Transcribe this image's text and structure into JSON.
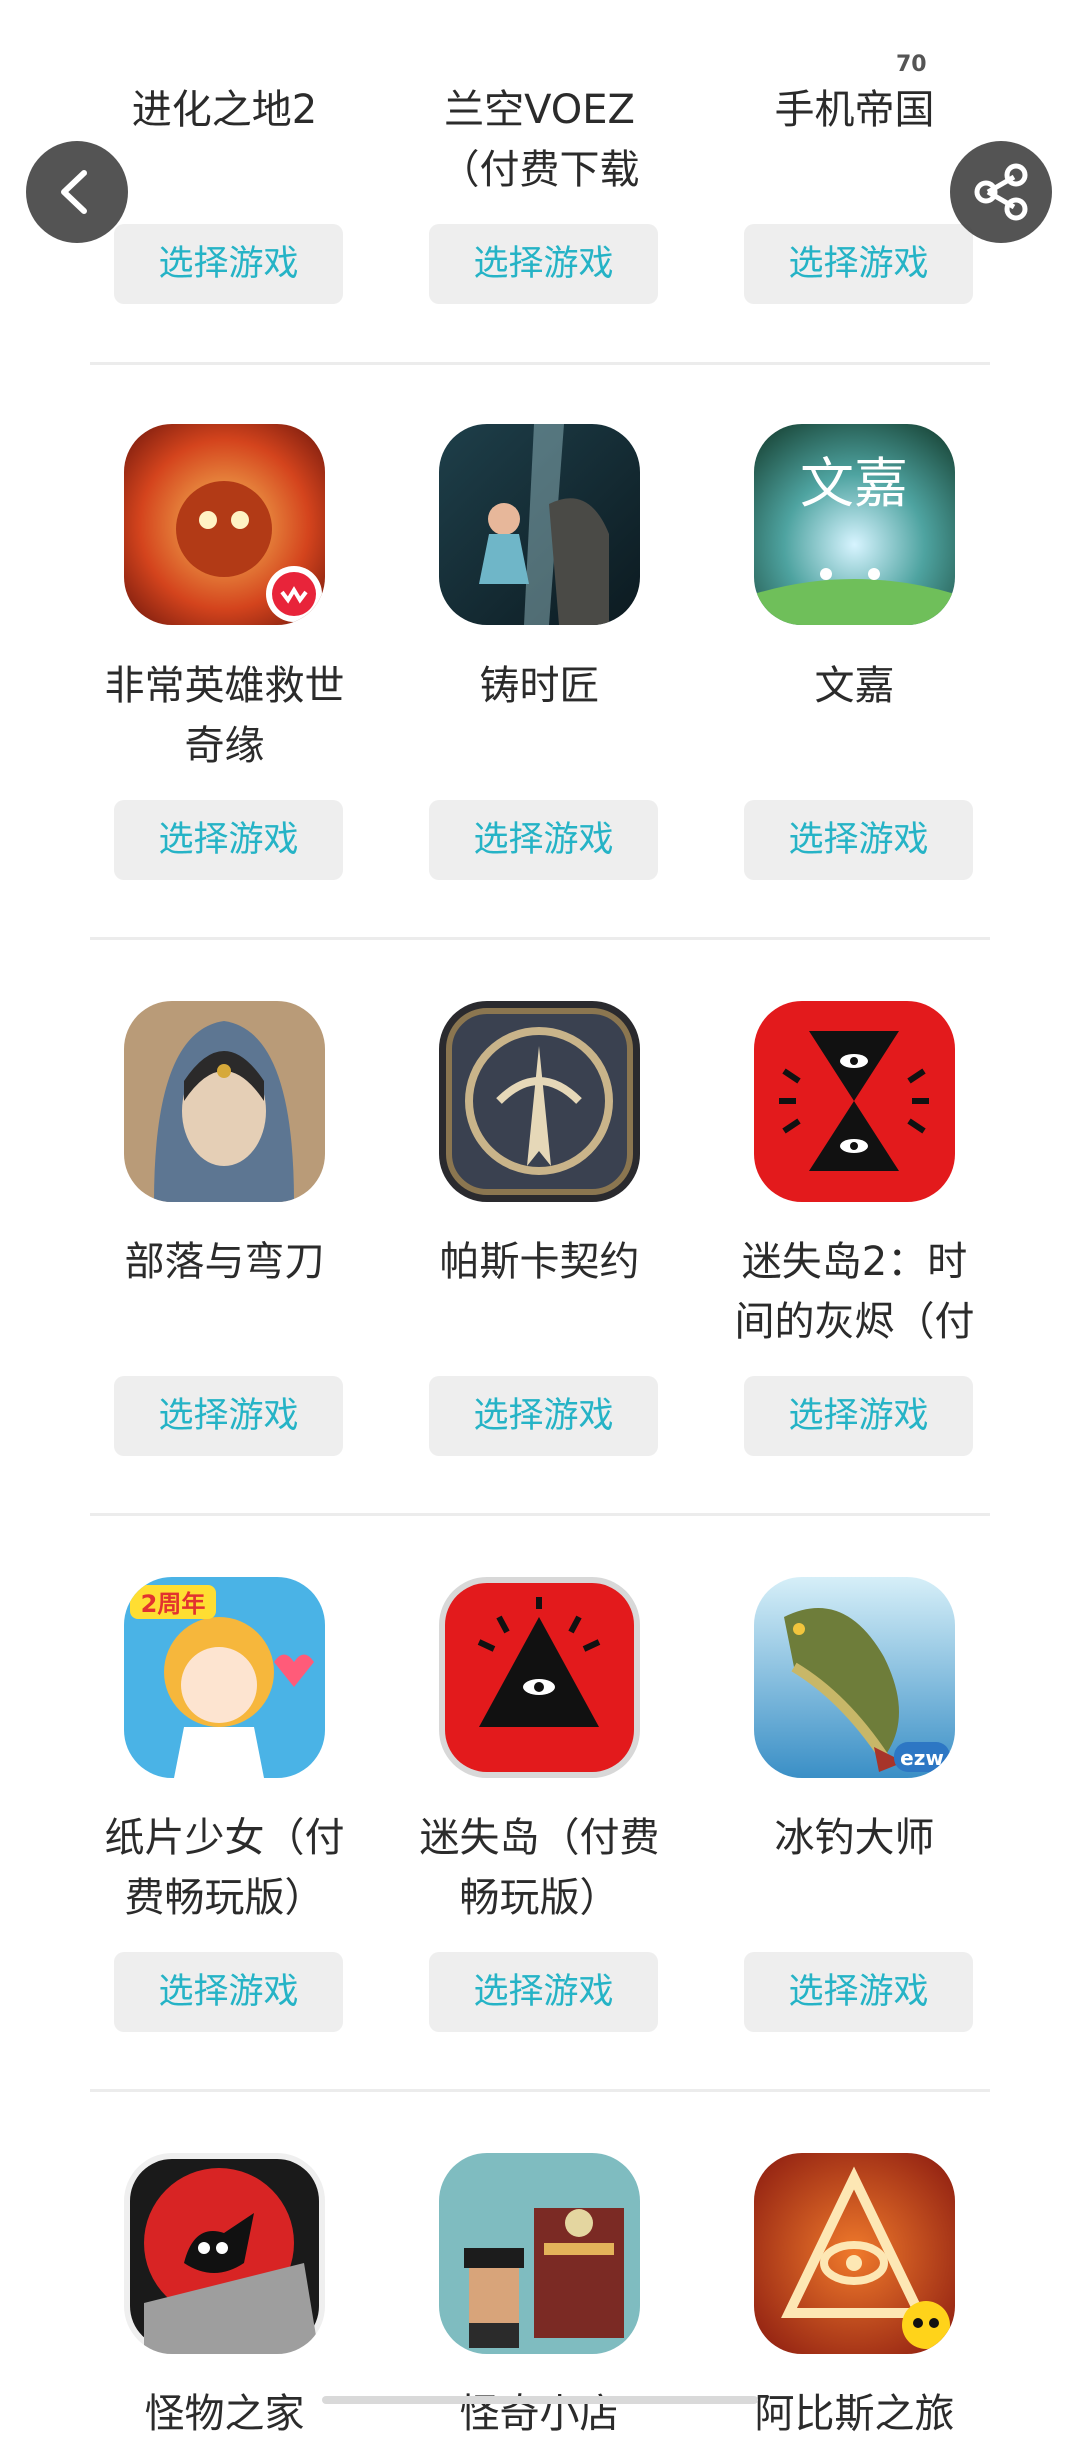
{
  "button_label": "选择游戏",
  "floating": {
    "back": "back-icon",
    "share": "share-icon"
  },
  "badge": "70",
  "rows": [
    {
      "games": [
        {
          "name": "进化之地2"
        },
        {
          "name": "兰空VOEZ\n（付费下载"
        },
        {
          "name": "手机帝国"
        }
      ]
    },
    {
      "games": [
        {
          "name": "非常英雄救世\n奇缘"
        },
        {
          "name": "铸时匠"
        },
        {
          "name": "文嘉"
        }
      ]
    },
    {
      "games": [
        {
          "name": "部落与弯刀"
        },
        {
          "name": "帕斯卡契约"
        },
        {
          "name": "迷失岛2：时\n间的灰烬（付"
        }
      ]
    },
    {
      "games": [
        {
          "name": "纸片少女（付\n费畅玩版）"
        },
        {
          "name": "迷失岛（付费\n畅玩版）"
        },
        {
          "name": "冰钓大师"
        }
      ]
    },
    {
      "games": [
        {
          "name": "怪物之家"
        },
        {
          "name": "怪奇小店"
        },
        {
          "name": "阿比斯之旅"
        }
      ]
    }
  ],
  "icon_texts": {
    "wenjia": "文嘉",
    "zhipian_badge": "2周年",
    "fishing_badge": "ezw"
  }
}
